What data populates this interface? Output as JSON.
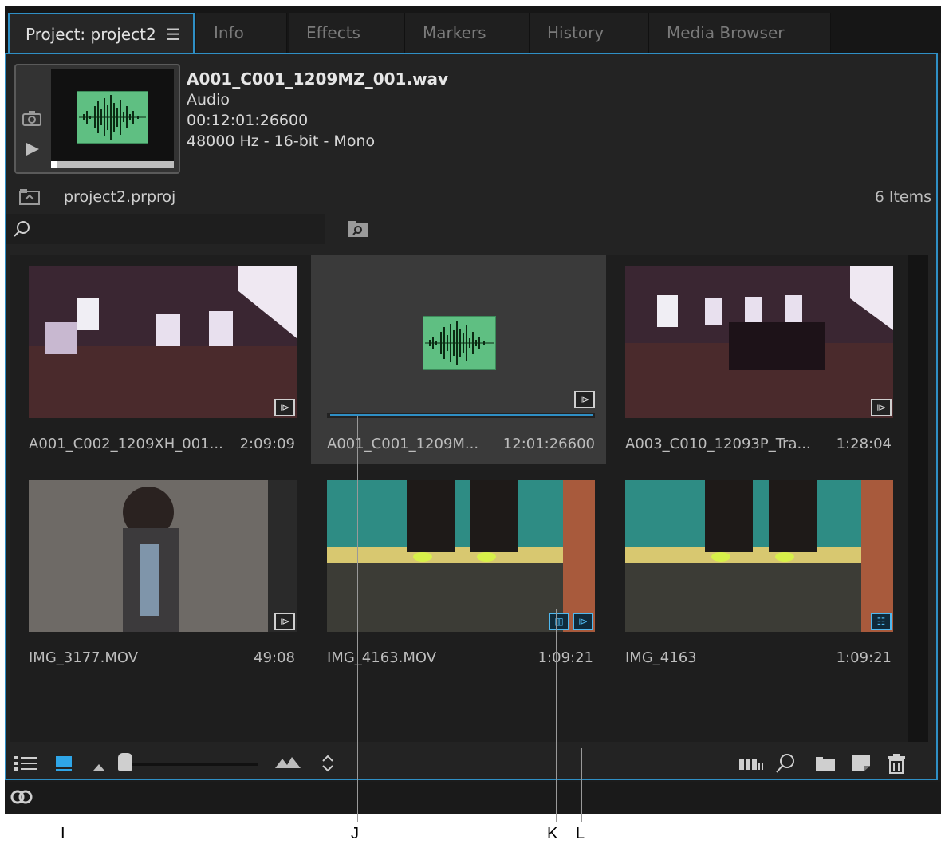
{
  "tabs": [
    {
      "label": "Project: project2",
      "active": true
    },
    {
      "label": "Info"
    },
    {
      "label": "Effects"
    },
    {
      "label": "Markers"
    },
    {
      "label": "History"
    },
    {
      "label": "Media Browser"
    }
  ],
  "menu_icon": "hamburger-menu-icon",
  "preview": {
    "filename": "A001_C001_1209MZ_001.wav",
    "type": "Audio",
    "timecode": "00:12:01:26600",
    "format": "48000 Hz - 16-bit - Mono"
  },
  "project": {
    "name": "project2.prproj",
    "items_count": "6 Items"
  },
  "clips": [
    {
      "name": "A001_C002_1209XH_001...",
      "duration": "2:09:09"
    },
    {
      "name": "A001_C001_1209M...",
      "duration": "12:01:26600",
      "selected": true
    },
    {
      "name": "A003_C010_12093P_Tra...",
      "duration": "1:28:04"
    },
    {
      "name": "IMG_3177.MOV",
      "duration": "49:08"
    },
    {
      "name": "IMG_4163.MOV",
      "duration": "1:09:21"
    },
    {
      "name": "IMG_4163",
      "duration": "1:09:21"
    }
  ],
  "callouts": {
    "i": "I",
    "j": "J",
    "k": "K",
    "l": "L"
  },
  "colors": {
    "accent": "#2f8fc5",
    "waveform": "#5fbf82"
  }
}
